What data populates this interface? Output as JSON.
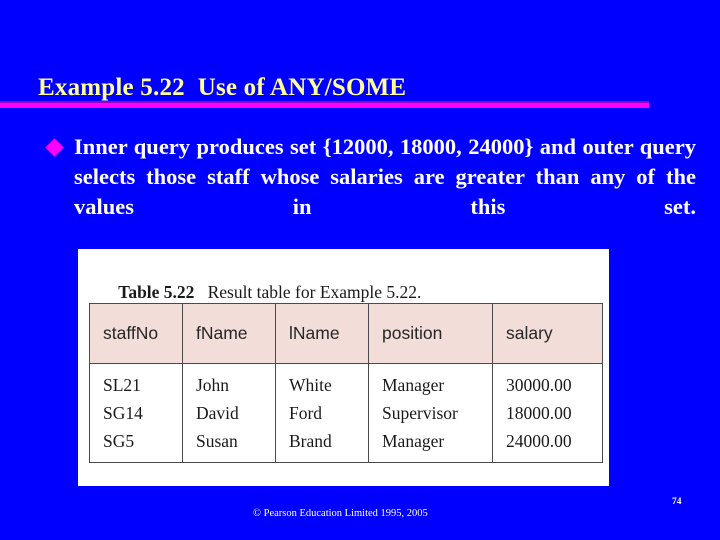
{
  "slide": {
    "background_color": "#0000fe",
    "title": "Example 5.22  Use of ANY/SOME",
    "title_color": "#ffff99",
    "rule_color": "#ff00ff",
    "bullet": {
      "marker": "diamond-bullet",
      "marker_color": "#ff00ff",
      "text": "Inner query produces set {12000, 18000, 24000} and outer query selects those staff whose salaries are greater than any of the values in this set."
    }
  },
  "table_panel": {
    "caption_label": "Table 5.22",
    "caption_spacer": "   ",
    "caption_description": "Result table for Example 5.22.",
    "header_background": "#f2ddd8",
    "columns": [
      "staffNo",
      "fName",
      "lName",
      "position",
      "salary"
    ],
    "rows": [
      {
        "staffNo": "SL21",
        "fName": "John",
        "lName": "White",
        "position": "Manager",
        "salary": "30000.00"
      },
      {
        "staffNo": "SG14",
        "fName": "David",
        "lName": "Ford",
        "position": "Supervisor",
        "salary": "18000.00"
      },
      {
        "staffNo": "SG5",
        "fName": "Susan",
        "lName": "Brand",
        "position": "Manager",
        "salary": "24000.00"
      }
    ]
  },
  "footer": {
    "copyright": "© Pearson Education Limited 1995, 2005",
    "page_number": "74"
  }
}
